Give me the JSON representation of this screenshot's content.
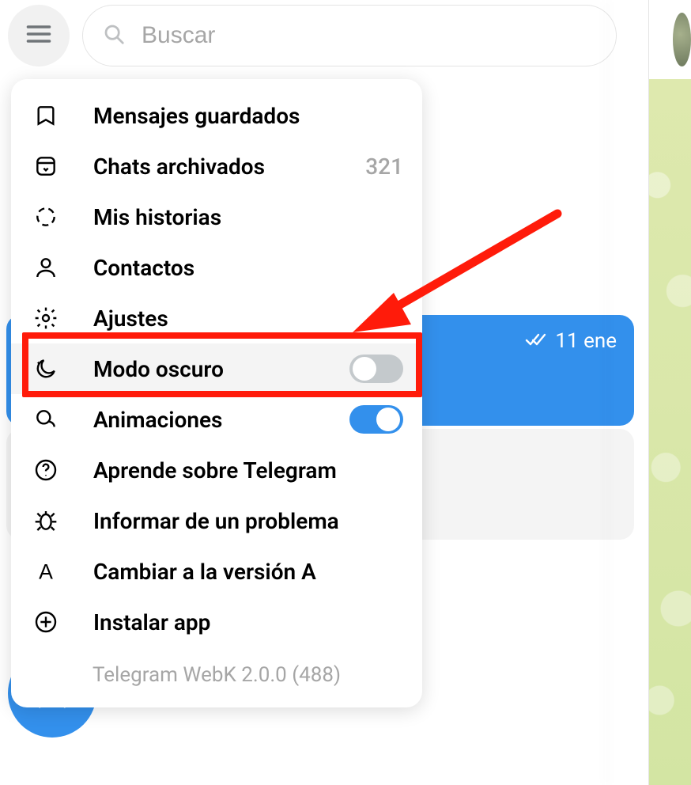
{
  "search": {
    "placeholder": "Buscar"
  },
  "menu": {
    "saved": "Mensajes guardados",
    "archived": "Chats archivados",
    "archived_count": "321",
    "stories": "Mis historias",
    "contacts": "Contactos",
    "settings": "Ajustes",
    "dark_mode": "Modo oscuro",
    "animations": "Animaciones",
    "learn": "Aprende sobre Telegram",
    "report": "Informar de un problema",
    "switch_a": "Cambiar a la versión A",
    "install": "Instalar app",
    "footer": "Telegram WebK 2.0.0 (488)"
  },
  "chat": {
    "active_date": "11 ene"
  }
}
